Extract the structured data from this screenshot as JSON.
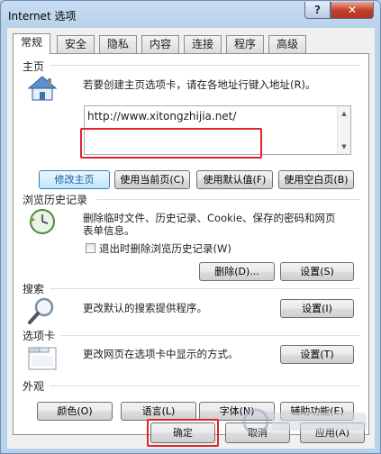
{
  "window": {
    "title": "Internet 选项",
    "help_label": "?",
    "close_label": "✕"
  },
  "tabs": [
    "常规",
    "安全",
    "隐私",
    "内容",
    "连接",
    "程序",
    "高级"
  ],
  "homepage": {
    "title": "主页",
    "desc": "若要创建主页选项卡，请在各地址行键入地址(R)。",
    "url": "http://www.xitongzhijia.net/",
    "buttons": [
      "修改主页",
      "使用当前页(C)",
      "使用默认值(F)",
      "使用空白页(B)"
    ]
  },
  "history": {
    "title": "浏览历史记录",
    "desc_line1": "删除临时文件、历史记录、Cookie、保存的密码和网页",
    "desc_line2": "表单信息。",
    "checkbox_label": "退出时删除浏览历史记录(W)",
    "delete_label": "删除(D)...",
    "settings_label": "设置(S)"
  },
  "search": {
    "title": "搜索",
    "desc": "更改默认的搜索提供程序。",
    "settings_label": "设置(I)"
  },
  "tabs_section": {
    "title": "选项卡",
    "desc": "更改网页在选项卡中显示的方式。",
    "settings_label": "设置(T)"
  },
  "appearance": {
    "title": "外观",
    "buttons": [
      "颜色(O)",
      "语言(L)",
      "字体(N)",
      "辅助功能(E)"
    ]
  },
  "footer": {
    "ok_label": "确定",
    "cancel_label": "取消",
    "apply_label": "应用(A)"
  },
  "colors": {
    "highlight_red": "#e0242c",
    "accent": "#3c7fb1"
  }
}
